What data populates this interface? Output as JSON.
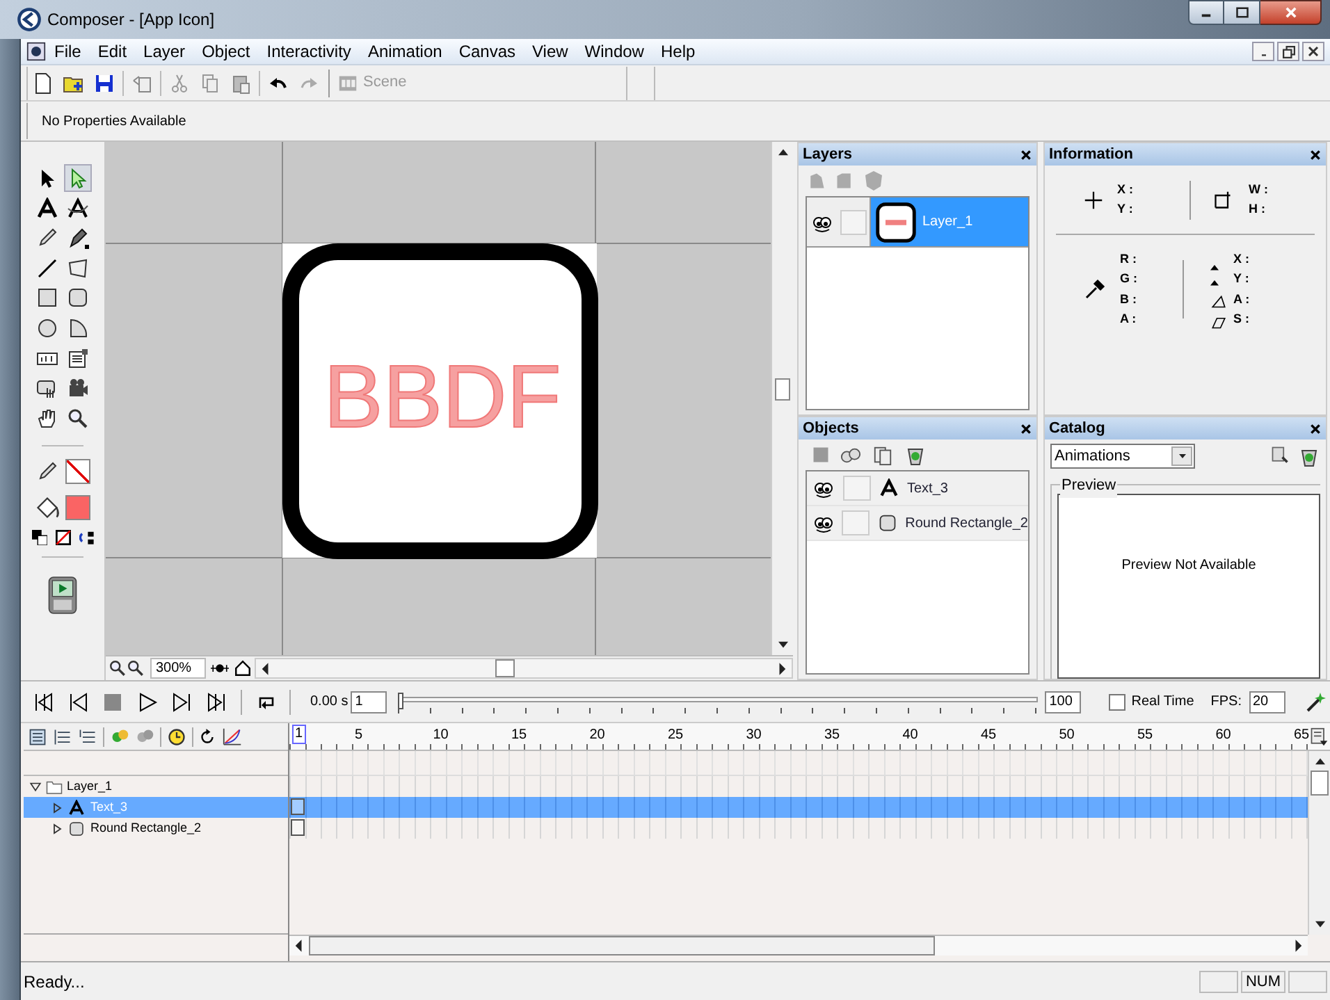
{
  "window": {
    "title": "Composer - [App Icon]"
  },
  "menu": [
    "File",
    "Edit",
    "Layer",
    "Object",
    "Interactivity",
    "Animation",
    "Canvas",
    "View",
    "Window",
    "Help"
  ],
  "toolbar": {
    "scene": "Scene"
  },
  "properties": {
    "message": "No Properties Available"
  },
  "toolbox": {
    "tools": [
      {
        "kind": "pointer",
        "selected": false
      },
      {
        "kind": "subselect",
        "selected": true
      },
      {
        "kind": "text",
        "selected": false
      },
      {
        "kind": "text-path",
        "selected": false
      },
      {
        "kind": "pencil",
        "selected": false
      },
      {
        "kind": "pen",
        "selected": false
      },
      {
        "kind": "line",
        "selected": false
      },
      {
        "kind": "polygon",
        "selected": false
      },
      {
        "kind": "rect",
        "selected": false
      },
      {
        "kind": "round-rect",
        "selected": false
      },
      {
        "kind": "ellipse",
        "selected": false
      },
      {
        "kind": "pie",
        "selected": false
      },
      {
        "kind": "text-field",
        "selected": false
      },
      {
        "kind": "menu",
        "selected": false
      },
      {
        "kind": "button",
        "selected": false
      },
      {
        "kind": "movie",
        "selected": false
      },
      {
        "kind": "hand",
        "selected": false
      },
      {
        "kind": "zoom",
        "selected": false
      }
    ],
    "fill": {
      "color": "#fa6464"
    }
  },
  "canvas": {
    "text": "BBDF",
    "zoom": "300%"
  },
  "layers": {
    "title": "Layers",
    "rows": [
      {
        "name": "Layer_1",
        "selected": true
      }
    ]
  },
  "information": {
    "title": "Information",
    "position": [
      "X :",
      "Y :"
    ],
    "size": [
      "W :",
      "H :"
    ],
    "rgba": [
      "R :",
      "G :",
      "B :",
      "A :"
    ],
    "delta": [
      "X :",
      "Y :",
      "A :",
      "S :"
    ]
  },
  "objects": {
    "title": "Objects",
    "rows": [
      {
        "kind": "text",
        "name": "Text_3"
      },
      {
        "kind": "round-rect",
        "name": "Round Rectangle_2"
      }
    ]
  },
  "catalog": {
    "title": "Catalog",
    "dropdown": "Animations",
    "preview_label": "Preview",
    "preview_message": "Preview Not Available"
  },
  "playback": {
    "time": "0.00 s",
    "frame": "1",
    "end_frame": "100",
    "level": 0,
    "real_time": {
      "label": "Real Time",
      "checked": false
    },
    "fps_label": "FPS:",
    "fps": "20"
  },
  "timeline": {
    "ruler": [
      "1",
      "5",
      "10",
      "15",
      "20",
      "25",
      "30",
      "35",
      "40",
      "45",
      "50",
      "55",
      "60",
      "65"
    ],
    "layers": [
      {
        "name": "Layer_1",
        "expanded": true,
        "children": [
          {
            "kind": "text",
            "name": "Text_3",
            "selected": true
          },
          {
            "kind": "round-rect",
            "name": "Round Rectangle_2",
            "selected": false
          }
        ]
      }
    ]
  },
  "status_bar": {
    "message": "Ready...",
    "num": "NUM"
  }
}
